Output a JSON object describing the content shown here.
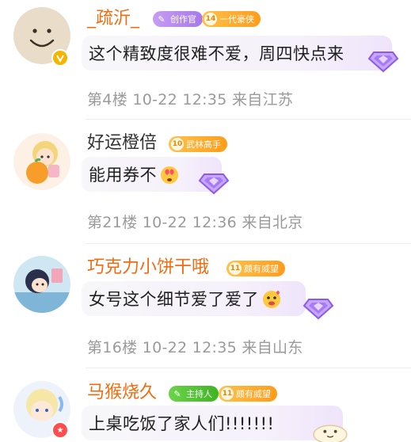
{
  "comments": [
    {
      "username": "_疏沂_",
      "badges": [
        {
          "label": "创作官",
          "icon": "creator-icon",
          "color": "#b78cf0"
        },
        {
          "level": "14",
          "label": "一代豪侠",
          "color": "#ffb02e"
        }
      ],
      "text": "这个精致度很难不爱，周四快点来",
      "floor": "第4楼",
      "time": "10-22 12:35",
      "location": "来自江苏"
    },
    {
      "username": "好运橙倍",
      "badges": [
        {
          "level": "10",
          "label": "武林高手",
          "color": "#ffb02e"
        }
      ],
      "text": "能用券不",
      "floor": "第21楼",
      "time": "10-22 12:36",
      "location": "来自北京"
    },
    {
      "username": "巧克力小饼干哦",
      "badges": [
        {
          "level": "11",
          "label": "颇有威望",
          "color": "#ffb02e"
        }
      ],
      "text": "女号这个细节爱了爱了",
      "floor": "第16楼",
      "time": "10-22 12:35",
      "location": "来自山东"
    },
    {
      "username": "马猴烧久",
      "badges": [
        {
          "label": "主持人",
          "icon": "moderator-icon",
          "color": "#52c41a"
        },
        {
          "level": "11",
          "label": "颇有威望",
          "color": "#ffb02e"
        }
      ],
      "text": "上桌吃饭了家人们!!!!!!!"
    }
  ],
  "colors": {
    "username_vip": "#f26b0f",
    "meta_text": "#9a9a9a",
    "level_badge": "#ffb02e"
  }
}
